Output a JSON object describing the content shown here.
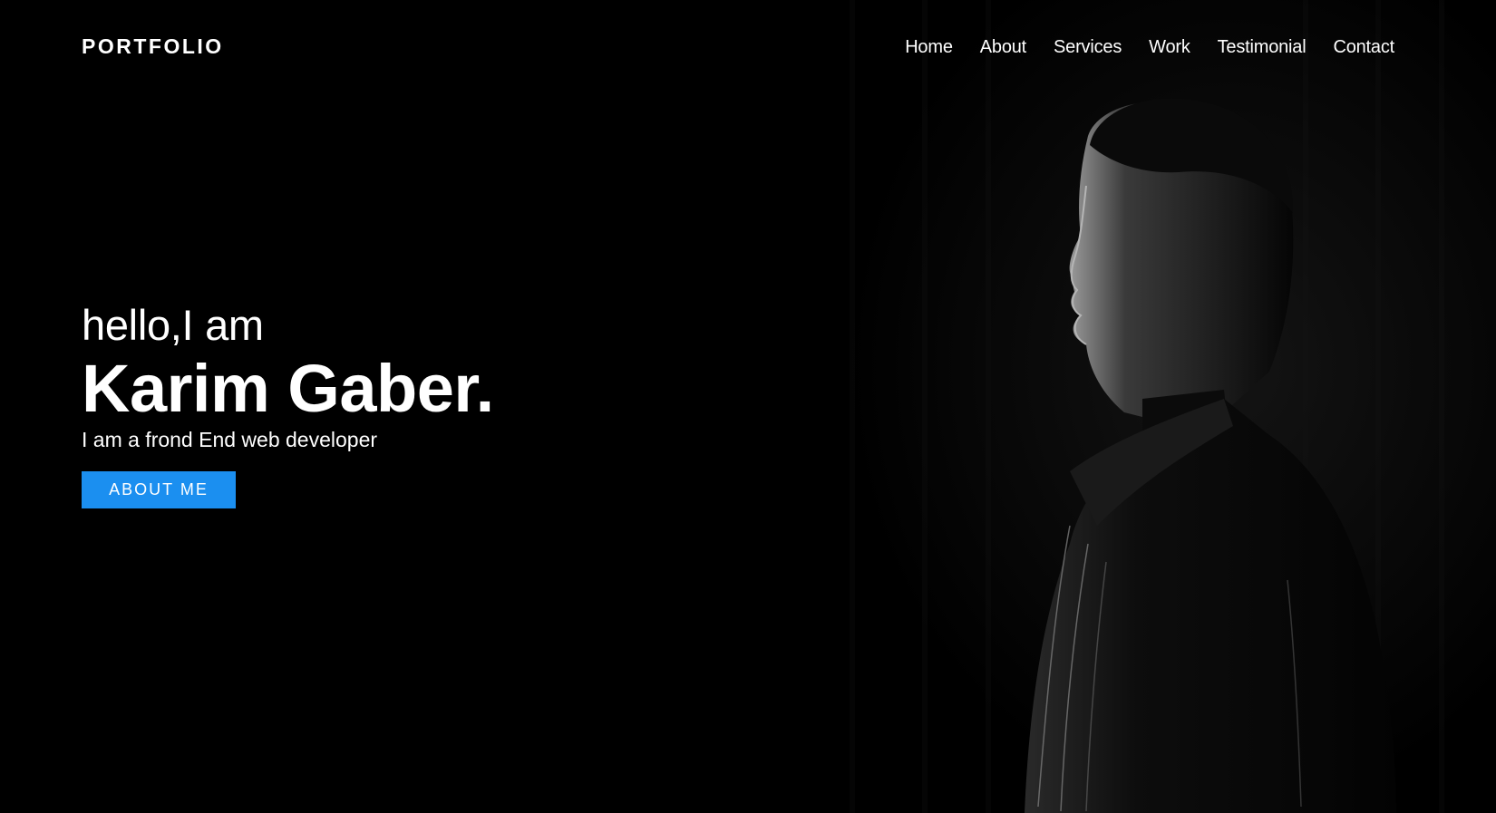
{
  "header": {
    "logo": "PORTFOLIO",
    "nav": [
      {
        "label": "Home"
      },
      {
        "label": "About"
      },
      {
        "label": "Services"
      },
      {
        "label": "Work"
      },
      {
        "label": "Testimonial"
      },
      {
        "label": "Contact"
      }
    ]
  },
  "hero": {
    "greeting": "hello,I am",
    "name": "Karim Gaber.",
    "tagline": "I am a frond End web developer",
    "cta_label": "ABOUT ME",
    "photo": "portrait-silhouette"
  },
  "colors": {
    "background": "#000000",
    "accent": "#1b8ff0",
    "text": "#ffffff"
  }
}
